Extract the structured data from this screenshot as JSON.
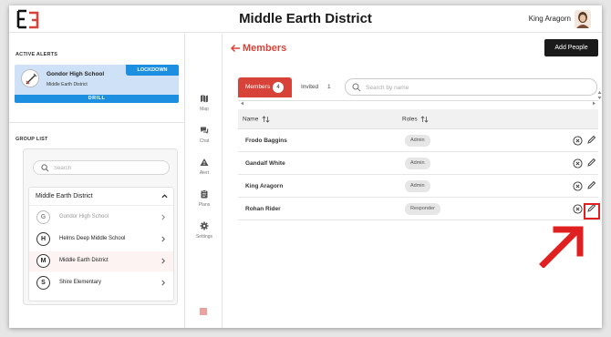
{
  "app": {
    "title": "Middle Earth District",
    "user_name": "King Aragorn",
    "brand_color": "#d74339"
  },
  "alerts": {
    "section_label": "ACTIVE ALERTS",
    "items": [
      {
        "school": "Gondor High School",
        "district": "Middle Earth District",
        "status": "LOCKDOWN",
        "type": "DRILL",
        "color": "#1d8fe0"
      }
    ]
  },
  "groups": {
    "section_label": "GROUP LIST",
    "search_placeholder": "Search",
    "district_title": "Middle Earth District",
    "schools": [
      {
        "letter": "G",
        "name": "Gondor High School",
        "state": "muted"
      },
      {
        "letter": "H",
        "name": "Helms Deep Middle School",
        "state": "normal"
      },
      {
        "letter": "M",
        "name": "Middle Earth District",
        "state": "active"
      },
      {
        "letter": "S",
        "name": "Shire Elementary",
        "state": "normal"
      }
    ]
  },
  "nav": {
    "items": [
      {
        "label": "Map",
        "icon": "map-icon"
      },
      {
        "label": "Chat",
        "icon": "chat-icon"
      },
      {
        "label": "Alert",
        "icon": "alert-icon"
      },
      {
        "label": "Plans",
        "icon": "plans-icon"
      },
      {
        "label": "Settings",
        "icon": "gear-icon"
      }
    ]
  },
  "page": {
    "title": "Members",
    "add_button": "Add People",
    "tabs": {
      "members_label": "Members",
      "members_count": "4",
      "invited_label": "Invited",
      "invited_count": "1"
    },
    "search_placeholder": "Search by name",
    "columns": {
      "name": "Name",
      "roles": "Roles"
    },
    "members": [
      {
        "name": "Frodo Baggins",
        "role": "Admin"
      },
      {
        "name": "Gandalf White",
        "role": "Admin"
      },
      {
        "name": "King Aragorn",
        "role": "Admin"
      },
      {
        "name": "Rohan Rider",
        "role": "Responder"
      }
    ]
  },
  "annotation": {
    "color": "#e02020"
  }
}
